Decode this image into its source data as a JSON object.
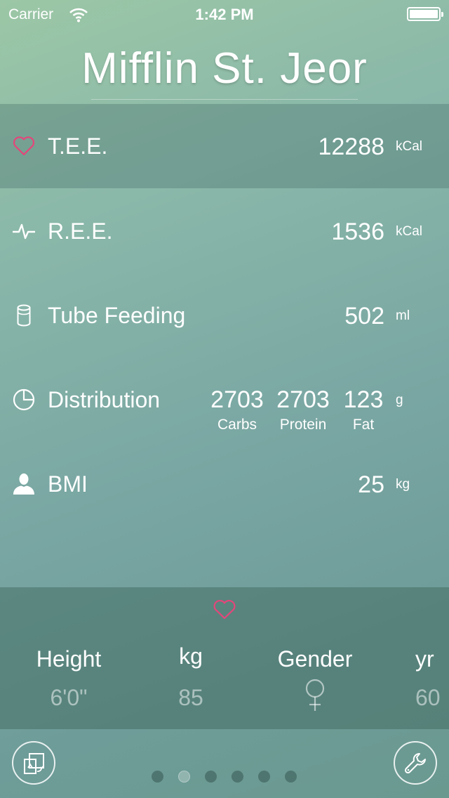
{
  "status_bar": {
    "carrier": "Carrier",
    "time": "1:42 PM",
    "battery": 1.0
  },
  "title": "Mifflin St. Jeor",
  "rows": [
    {
      "label": "T.E.E.",
      "value": "12288",
      "unit": "kCal",
      "icon": "heart-icon"
    },
    {
      "label": "R.E.E.",
      "value": "1536",
      "unit": "kCal",
      "icon": "pulse-icon"
    },
    {
      "label": "Tube Feeding",
      "value": "502",
      "unit": "ml",
      "icon": "canister-icon"
    },
    {
      "label": "BMI",
      "value": "25",
      "unit": "kg",
      "icon": "person-icon"
    }
  ],
  "distribution": {
    "label": "Distribution",
    "unit": "g",
    "icon": "pie-chart-icon",
    "items": [
      {
        "value": "2703",
        "name": "Carbs"
      },
      {
        "value": "2703",
        "name": "Protein"
      },
      {
        "value": "123",
        "name": "Fat"
      }
    ]
  },
  "picker": {
    "icon": "heart-icon",
    "columns": [
      {
        "header": "Height",
        "value": "6'0\""
      },
      {
        "header": "kg",
        "value": "85"
      },
      {
        "header": "Gender",
        "value": "female-symbol"
      },
      {
        "header": "yr",
        "value": "60"
      }
    ]
  },
  "toolbar": {
    "left_icon": "formula-switch-icon",
    "right_icon": "wrench-icon",
    "page_count": 6,
    "active_page": 2
  },
  "colors": {
    "accent_heart": "#e5457a"
  }
}
